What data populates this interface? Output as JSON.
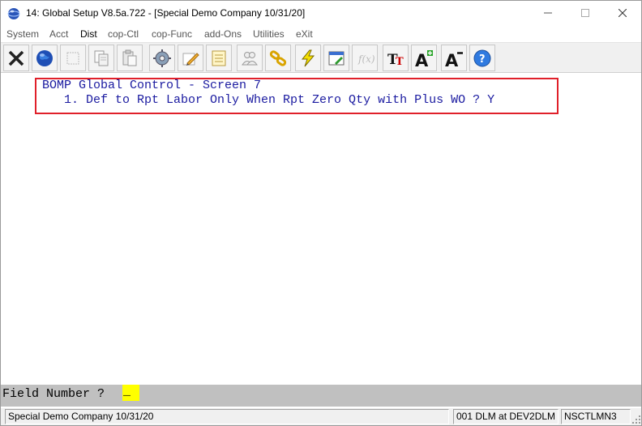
{
  "window": {
    "title": "14: Global Setup V8.5a.722 - [Special Demo Company 10/31/20]"
  },
  "menu": [
    {
      "label": "System"
    },
    {
      "label": "Acct"
    },
    {
      "label": "Dist"
    },
    {
      "label": "cop-Ctl"
    },
    {
      "label": "cop-Func"
    },
    {
      "label": "add-Ons"
    },
    {
      "label": "Utilities"
    },
    {
      "label": "eXit"
    }
  ],
  "toolbar": [
    {
      "icon": "close-x-icon"
    },
    {
      "icon": "globe-icon"
    },
    {
      "icon": "blank-icon"
    },
    {
      "icon": "copy-icon"
    },
    {
      "icon": "paste-icon"
    },
    {
      "icon": "settings-gear-icon"
    },
    {
      "icon": "edit-pencil-icon"
    },
    {
      "icon": "notes-icon"
    },
    {
      "icon": "users-icon"
    },
    {
      "icon": "link-chain-icon"
    },
    {
      "icon": "lightning-icon"
    },
    {
      "icon": "window-edit-icon"
    },
    {
      "icon": "function-icon"
    },
    {
      "icon": "font-icon"
    },
    {
      "icon": "font-increase-icon"
    },
    {
      "icon": "font-decrease-icon"
    },
    {
      "icon": "help-icon"
    }
  ],
  "screen": {
    "heading": "BOMP Global Control - Screen 7",
    "line1": "   1. Def to Rpt Labor Only When Rpt Zero Qty with Plus WO ? Y",
    "text_color": "#1a1aa0",
    "highlight_color": "#e0202a"
  },
  "prompt": {
    "label": "Field Number ? ",
    "value": "_"
  },
  "status": {
    "company": "Special Demo Company 10/31/20",
    "session": "001 DLM at DEV2DLM",
    "program": "NSCTLMN3"
  }
}
